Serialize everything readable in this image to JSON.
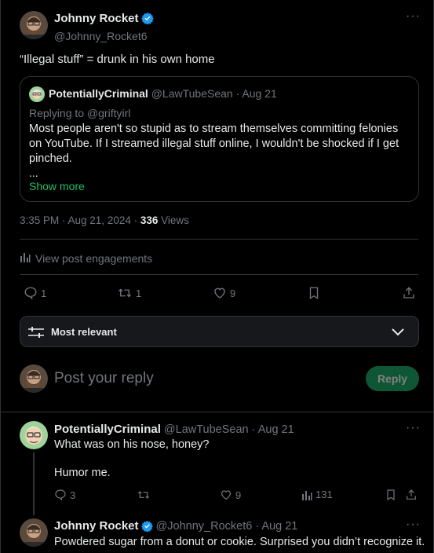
{
  "main_post": {
    "author_name": "Johnny Rocket",
    "author_handle": "@Johnny_Rocket6",
    "text": "“Illegal stuff” = drunk in his own home",
    "quote": {
      "author_name": "PotentiallyCriminal",
      "author_handle": "@LawTubeSean",
      "date": "Aug 21",
      "replying_to_prefix": "Replying to ",
      "replying_to_handle": "@griftyirl",
      "text": "Most people aren't so stupid as to stream themselves committing felonies on YouTube. If I streamed illegal stuff online, I wouldn't be shocked if I get pinched.",
      "ellipsis": "...",
      "show_more": "Show more"
    },
    "timestamp": "3:35 PM · Aug 21, 2024 · ",
    "views_count": "336",
    "views_label": " Views",
    "engagements_label": "View post engagements",
    "replies": "1",
    "reposts": "1",
    "likes": "9"
  },
  "sort": {
    "label": "Most relevant"
  },
  "composer": {
    "placeholder": "Post your reply",
    "button": "Reply"
  },
  "replies": [
    {
      "author_name": "PotentiallyCriminal",
      "author_handle": "@LawTubeSean",
      "date": "Aug 21",
      "line1": "What was on his nose, honey?",
      "line2": "Humor me.",
      "replies": "3",
      "reposts": "",
      "likes": "9",
      "views": "131"
    },
    {
      "author_name": "Johnny Rocket",
      "author_handle": "@Johnny_Rocket6",
      "date": "Aug 21",
      "text": "Powdered sugar from a donut or cookie. Surprised you didn’t recognize it."
    }
  ],
  "colors": {
    "accent_green": "#1d9e5f",
    "link_green": "#1fbf6b",
    "verified": "#1d9bf0",
    "muted": "#71767b",
    "border": "#2f3336"
  }
}
